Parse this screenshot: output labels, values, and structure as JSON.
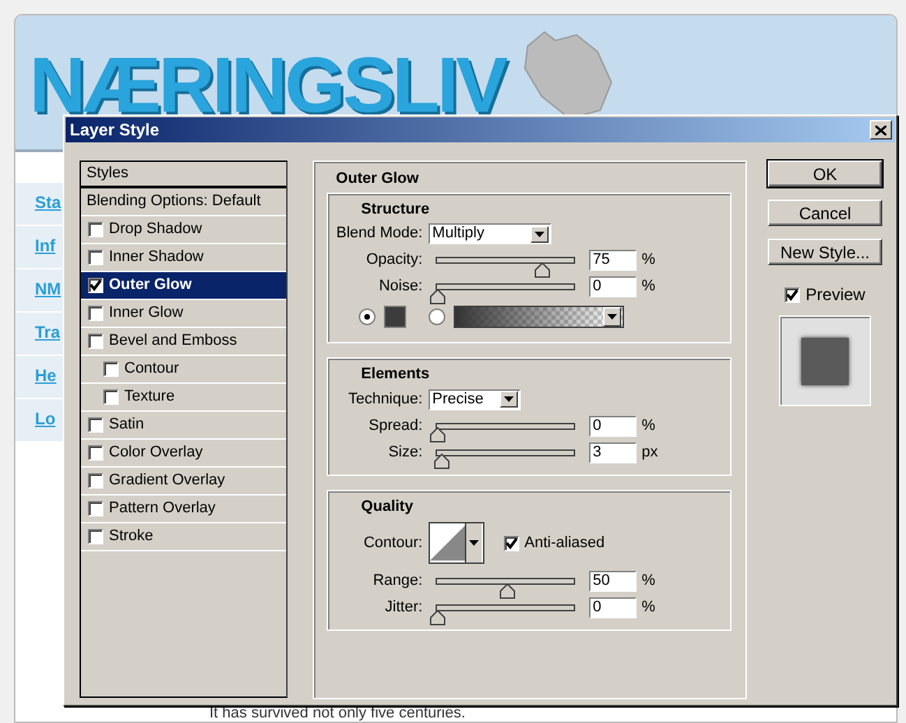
{
  "website": {
    "logo": "NÆRINGSLIV",
    "nav_items": [
      "Sta",
      "Inf",
      "NM",
      "Tra",
      "He",
      "Lo"
    ],
    "body_text": "It has survived not only five centuries."
  },
  "dialog": {
    "title": "Layer Style",
    "styles_list": {
      "header": "Styles",
      "blending": "Blending Options: Default",
      "items": [
        {
          "label": "Drop Shadow",
          "checked": false,
          "selected": false
        },
        {
          "label": "Inner Shadow",
          "checked": false,
          "selected": false
        },
        {
          "label": "Outer Glow",
          "checked": true,
          "selected": true
        },
        {
          "label": "Inner Glow",
          "checked": false,
          "selected": false
        },
        {
          "label": "Bevel and Emboss",
          "checked": false,
          "selected": false,
          "children": [
            {
              "label": "Contour",
              "checked": false,
              "selected": false
            },
            {
              "label": "Texture",
              "checked": false,
              "selected": false
            }
          ]
        },
        {
          "label": "Satin",
          "checked": false,
          "selected": false
        },
        {
          "label": "Color Overlay",
          "checked": false,
          "selected": false
        },
        {
          "label": "Gradient Overlay",
          "checked": false,
          "selected": false
        },
        {
          "label": "Pattern Overlay",
          "checked": false,
          "selected": false
        },
        {
          "label": "Stroke",
          "checked": false,
          "selected": false
        }
      ]
    },
    "panel": {
      "title": "Outer Glow",
      "structure": {
        "title": "Structure",
        "blend_mode": {
          "label": "Blend Mode:",
          "value": "Multiply"
        },
        "sliders": [
          {
            "label": "Opacity:",
            "level": 0.75,
            "value": "75",
            "unit": "%"
          },
          {
            "label": "Noise:",
            "level": 0,
            "value": "0",
            "unit": "%"
          }
        ],
        "fill_options": [
          {
            "kind": "color",
            "selected": true
          },
          {
            "kind": "gradient",
            "selected": false
          }
        ]
      },
      "elements": {
        "title": "Elements",
        "technique": {
          "label": "Technique:",
          "value": "Precise"
        },
        "sliders": [
          {
            "label": "Spread:",
            "level": 0,
            "value": "0",
            "unit": "%"
          },
          {
            "label": "Size:",
            "level": 0.03,
            "value": "3",
            "unit": "px"
          }
        ]
      },
      "quality": {
        "title": "Quality",
        "contour_label": "Contour:",
        "anti_aliased": {
          "label": "Anti-aliased",
          "checked": true
        },
        "sliders": [
          {
            "label": "Range:",
            "level": 0.5,
            "value": "50",
            "unit": "%"
          },
          {
            "label": "Jitter:",
            "level": 0,
            "value": "0",
            "unit": "%"
          }
        ]
      }
    },
    "buttons": [
      "OK",
      "Cancel",
      "New Style..."
    ],
    "preview": {
      "label": "Preview",
      "checked": true
    }
  }
}
